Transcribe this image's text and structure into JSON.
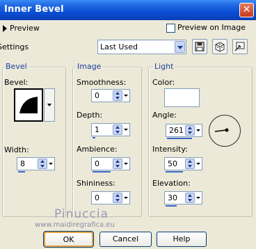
{
  "window": {
    "title": "Inner Bevel",
    "close_glyph": "✕"
  },
  "preview": {
    "label": "Preview",
    "preview_on_image_label": "Preview on Image",
    "preview_on_image_checked": false
  },
  "settings": {
    "label": "Settings",
    "selected": "Last Used"
  },
  "bevel": {
    "group_title": "Bevel",
    "bevel_label": "Bevel:",
    "width_label": "Width:",
    "width_value": "8"
  },
  "image": {
    "group_title": "Image",
    "smoothness_label": "Smoothness:",
    "smoothness_value": "0",
    "depth_label": "Depth:",
    "depth_value": "1",
    "ambience_label": "Ambience:",
    "ambience_value": "0",
    "shininess_label": "Shininess:",
    "shininess_value": "0"
  },
  "light": {
    "group_title": "Light",
    "color_label": "Color:",
    "color": "#ffffff",
    "angle_label": "Angle:",
    "angle_value": "261",
    "intensity_label": "Intensity:",
    "intensity_value": "50",
    "elevation_label": "Elevation:",
    "elevation_value": "30"
  },
  "watermark": {
    "name": "Pinuccia",
    "url": "www.maidiregrafica.eu"
  },
  "buttons": {
    "ok": "OK",
    "cancel": "Cancel",
    "help": "Help"
  },
  "icons": [
    "save-preset-icon",
    "randomize-icon",
    "reset-icon",
    "angle-dial-icon"
  ]
}
